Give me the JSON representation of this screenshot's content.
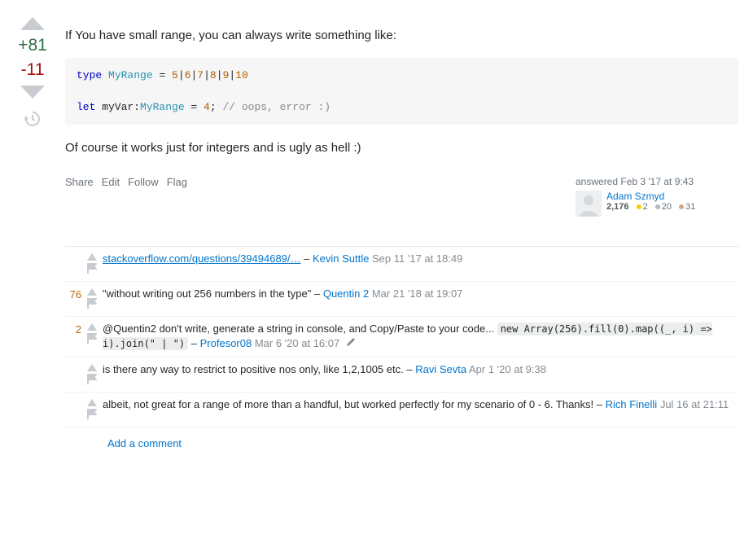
{
  "vote": {
    "up_score": "+81",
    "down_score": "-11"
  },
  "post": {
    "intro": "If You have small range, you can always write something like:",
    "outro": "Of course it works just for integers and is ugly as hell :)",
    "menu": {
      "share": "Share",
      "edit": "Edit",
      "follow": "Follow",
      "flag": "Flag"
    },
    "user": {
      "action_line": "answered Feb 3 '17 at 9:43",
      "name": "Adam Szmyd",
      "rep": "2,176",
      "gold": "2",
      "silver": "20",
      "bronze": "31"
    }
  },
  "code": {
    "kw_type": "type",
    "typename": "MyRange",
    "eq": " = ",
    "n1": "5",
    "n2": "6",
    "n3": "7",
    "n4": "8",
    "n5": "9",
    "n6": "10",
    "kw_let": "let",
    "varname": " myVar:",
    "eq2": " = ",
    "four": "4",
    "semi": "; ",
    "comment": "// oops, error :)"
  },
  "comments": [
    {
      "score": "",
      "body_link": "stackoverflow.com/questions/39494689/…",
      "sep": " – ",
      "user": "Kevin Suttle",
      "date": "Sep 11 '17 at 18:49"
    },
    {
      "score": "76",
      "body_text": "\"without writing out 256 numbers in the type\"",
      "sep": " – ",
      "user": "Quentin 2",
      "date": "Mar 21 '18 at 19:07"
    },
    {
      "score": "2",
      "body_text_pre": "@Quentin2 don't write, generate a string in console, and Copy/Paste to your code... ",
      "code": "new Array(256).fill(0).map((_, i) => i).join(\" | \")",
      "sep": " – ",
      "user": "Profesor08",
      "date": "Mar 6 '20 at 16:07",
      "editable": true
    },
    {
      "score": "",
      "body_text": "is there any way to restrict to positive nos only, like 1,2,1005 etc.",
      "sep": " – ",
      "user": "Ravi Sevta",
      "date": "Apr 1 '20 at 9:38"
    },
    {
      "score": "",
      "body_text": "albeit, not great for a range of more than a handful, but worked perfectly for my scenario of 0 - 6. Thanks!",
      "sep": " – ",
      "user": "Rich Finelli",
      "date": "Jul 16 at 21:11"
    }
  ],
  "add_comment": "Add a comment"
}
